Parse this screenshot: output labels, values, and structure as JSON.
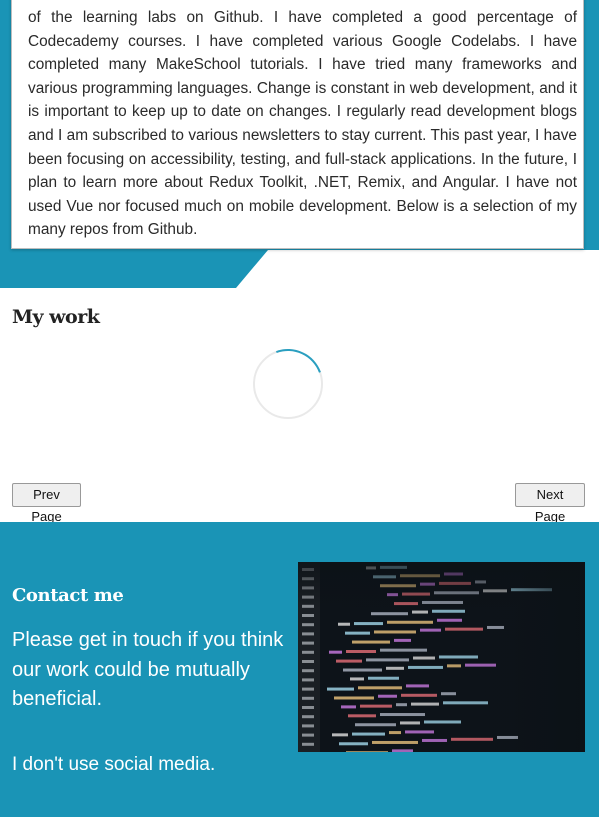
{
  "about": {
    "text": "of the learning labs on Github. I have completed a good percentage of Codecademy courses. I have completed various Google Codelabs. I have completed many MakeSchool tutorials. I have tried many frameworks and various programming languages. Change is constant in web development, and it is important to keep up to date on changes. I regularly read development blogs and I am subscribed to various newsletters to stay current. This past year, I have been focusing on accessibility, testing, and full-stack applications. In the future, I plan to learn more about Redux Toolkit, .NET, Remix, and Angular. I have not used Vue nor focused much on mobile development. Below is a selection of my many repos from Github."
  },
  "work": {
    "title": "My work",
    "prev_label": "Prev Page",
    "next_label": "Next Page"
  },
  "contact": {
    "title": "Contact me",
    "message": "Please get in touch if you think our work could be mutually beneficial.",
    "social": "I don't use social media.",
    "image_icon": "code-screenshot-image"
  },
  "colors": {
    "accent": "#1a94b6",
    "spinner": "#2a9fc0"
  }
}
